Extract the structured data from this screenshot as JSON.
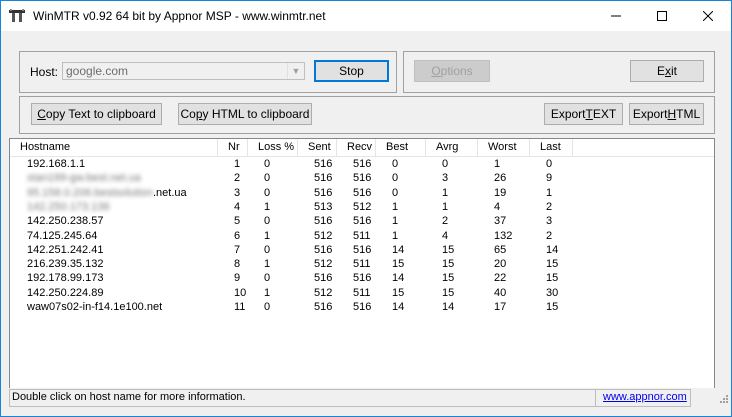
{
  "window": {
    "title": "WinMTR v0.92 64 bit by Appnor MSP - www.winmtr.net",
    "minimize_glyph": "—",
    "maximize_glyph": "☐",
    "close_glyph": "✕"
  },
  "host_group": {
    "host_label": "Host:",
    "host_value": "google.com",
    "stop_label": "Stop",
    "options_label": "Options",
    "exit_label": "Exit"
  },
  "toolbar": {
    "copy_text_label": "Copy Text to clipboard",
    "copy_html_label": "Copy HTML to clipboard",
    "export_text_label": "Export TEXT",
    "export_html_label": "Export HTML"
  },
  "table": {
    "columns": [
      "Hostname",
      "Nr",
      "Loss %",
      "Sent",
      "Recv",
      "Best",
      "Avrg",
      "Worst",
      "Last"
    ],
    "rows": [
      {
        "host": "192.168.1.1",
        "blurred": false,
        "nr": "1",
        "loss": "0",
        "sent": "516",
        "recv": "516",
        "best": "0",
        "avrg": "0",
        "worst": "1",
        "last": "0"
      },
      {
        "host": "xtan199-gw.best.net.ua",
        "blurred": true,
        "nr": "2",
        "loss": "0",
        "sent": "516",
        "recv": "516",
        "best": "0",
        "avrg": "3",
        "worst": "26",
        "last": "9"
      },
      {
        "host": ".net.ua",
        "blur_prefix": "95.158.0.206.bestsolution",
        "blurred": false,
        "nr": "3",
        "loss": "0",
        "sent": "516",
        "recv": "516",
        "best": "0",
        "avrg": "1",
        "worst": "19",
        "last": "1"
      },
      {
        "host": "142.250.173.136",
        "blurred": true,
        "nr": "4",
        "loss": "1",
        "sent": "513",
        "recv": "512",
        "best": "1",
        "avrg": "1",
        "worst": "4",
        "last": "2"
      },
      {
        "host": "142.250.238.57",
        "blurred": false,
        "nr": "5",
        "loss": "0",
        "sent": "516",
        "recv": "516",
        "best": "1",
        "avrg": "2",
        "worst": "37",
        "last": "3"
      },
      {
        "host": "74.125.245.64",
        "blurred": false,
        "nr": "6",
        "loss": "1",
        "sent": "512",
        "recv": "511",
        "best": "1",
        "avrg": "4",
        "worst": "132",
        "last": "2"
      },
      {
        "host": "142.251.242.41",
        "blurred": false,
        "nr": "7",
        "loss": "0",
        "sent": "516",
        "recv": "516",
        "best": "14",
        "avrg": "15",
        "worst": "65",
        "last": "14"
      },
      {
        "host": "216.239.35.132",
        "blurred": false,
        "nr": "8",
        "loss": "1",
        "sent": "512",
        "recv": "511",
        "best": "15",
        "avrg": "15",
        "worst": "20",
        "last": "15"
      },
      {
        "host": "192.178.99.173",
        "blurred": false,
        "nr": "9",
        "loss": "0",
        "sent": "516",
        "recv": "516",
        "best": "14",
        "avrg": "15",
        "worst": "22",
        "last": "15"
      },
      {
        "host": "142.250.224.89",
        "blurred": false,
        "nr": "10",
        "loss": "1",
        "sent": "512",
        "recv": "511",
        "best": "15",
        "avrg": "15",
        "worst": "40",
        "last": "30"
      },
      {
        "host": "waw07s02-in-f14.1e100.net",
        "blurred": false,
        "nr": "11",
        "loss": "0",
        "sent": "516",
        "recv": "516",
        "best": "14",
        "avrg": "14",
        "worst": "17",
        "last": "15"
      }
    ]
  },
  "statusbar": {
    "hint": "Double click on host name for more information.",
    "link": "www.appnor.com"
  },
  "colors": {
    "window_border": "#1883d7",
    "default_button": "#0078d7",
    "link": "#0000ee"
  }
}
